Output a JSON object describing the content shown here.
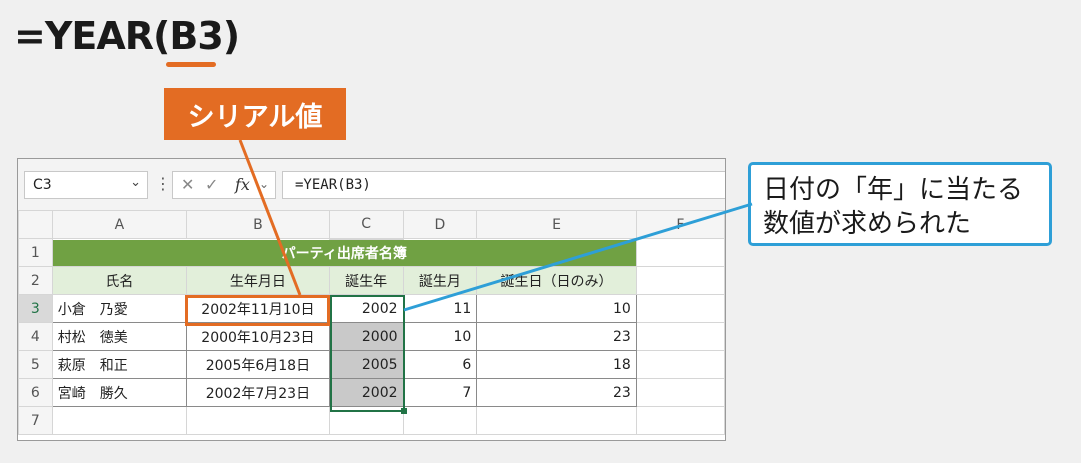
{
  "title": {
    "formula_prefix": "=YEAR(",
    "formula_arg": "B3",
    "formula_suffix": ")"
  },
  "labels": {
    "serial": "シリアル値",
    "callout_line1": "日付の「年」に当たる",
    "callout_line2": "数値が求められた"
  },
  "excel": {
    "name_box": "C3",
    "formula": "=YEAR(B3)",
    "fx": "fx",
    "columns": [
      "A",
      "B",
      "C",
      "D",
      "E",
      "F"
    ],
    "rows": [
      "1",
      "2",
      "3",
      "4",
      "5",
      "6",
      "7"
    ],
    "sheet_title": "パーティ出席者名簿",
    "headers": [
      "氏名",
      "生年月日",
      "誕生年",
      "誕生月",
      "誕生日（日のみ）"
    ],
    "data": [
      {
        "name": "小倉　乃愛",
        "birth": "2002年11月10日",
        "year": "2002",
        "month": "11",
        "day": "10"
      },
      {
        "name": "村松　徳美",
        "birth": "2000年10月23日",
        "year": "2000",
        "month": "10",
        "day": "23"
      },
      {
        "name": "萩原　和正",
        "birth": "2005年6月18日",
        "year": "2005",
        "month": "6",
        "day": "18"
      },
      {
        "name": "宮崎　勝久",
        "birth": "2002年7月23日",
        "year": "2002",
        "month": "7",
        "day": "23"
      }
    ]
  },
  "colors": {
    "accent_orange": "#e36c23",
    "accent_blue": "#2e9fd7",
    "excel_green": "#70a143"
  }
}
